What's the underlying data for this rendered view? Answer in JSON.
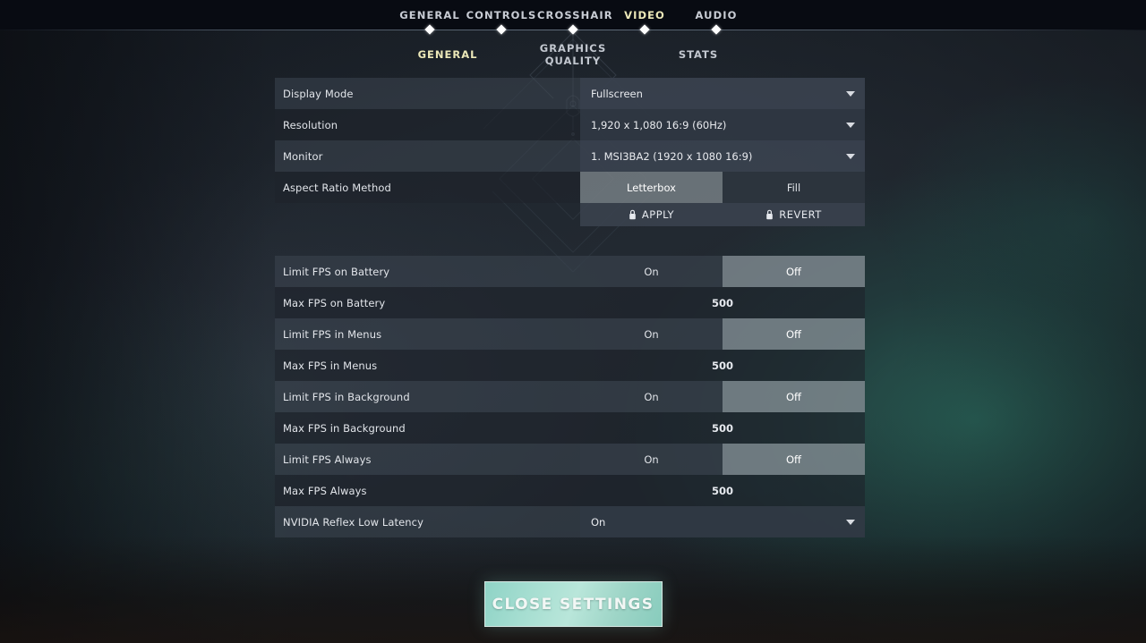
{
  "nav": {
    "main": [
      {
        "label": "GENERAL",
        "active": false
      },
      {
        "label": "CONTROLS",
        "active": false
      },
      {
        "label": "CROSSHAIR",
        "active": false
      },
      {
        "label": "VIDEO",
        "active": true
      },
      {
        "label": "AUDIO",
        "active": false
      }
    ],
    "sub": [
      {
        "label": "GENERAL",
        "active": true
      },
      {
        "label": "GRAPHICS QUALITY",
        "active": false
      },
      {
        "label": "STATS",
        "active": false
      }
    ]
  },
  "colors": {
    "active_tab": "#ece8b8",
    "tab": "#c8ccd4",
    "selected_option_bg": "#96a0a4",
    "close_button": "#a6ded1",
    "panel_row_light": "#3d4550",
    "panel_row_dark": "#1e242c"
  },
  "settings": {
    "display_mode": {
      "label": "Display Mode",
      "value": "Fullscreen",
      "type": "dropdown"
    },
    "resolution": {
      "label": "Resolution",
      "value": "1,920 x 1,080 16:9 (60Hz)",
      "type": "dropdown"
    },
    "monitor": {
      "label": "Monitor",
      "value": "1. MSI3BA2 (1920 x  1080 16:9)",
      "type": "dropdown"
    },
    "aspect_ratio_method": {
      "label": "Aspect Ratio Method",
      "type": "segmented",
      "options": [
        "Letterbox",
        "Fill"
      ],
      "selected": "Letterbox"
    },
    "actions": {
      "apply": "APPLY",
      "revert": "REVERT",
      "key_icon": "keybind-icon"
    },
    "limit_fps_battery": {
      "label": "Limit FPS on Battery",
      "type": "segmented",
      "options": [
        "On",
        "Off"
      ],
      "selected": "Off"
    },
    "max_fps_battery": {
      "label": "Max FPS on Battery",
      "value": "500",
      "type": "number"
    },
    "limit_fps_menus": {
      "label": "Limit FPS in Menus",
      "type": "segmented",
      "options": [
        "On",
        "Off"
      ],
      "selected": "Off"
    },
    "max_fps_menus": {
      "label": "Max FPS in Menus",
      "value": "500",
      "type": "number"
    },
    "limit_fps_background": {
      "label": "Limit FPS in Background",
      "type": "segmented",
      "options": [
        "On",
        "Off"
      ],
      "selected": "Off"
    },
    "max_fps_background": {
      "label": "Max FPS in Background",
      "value": "500",
      "type": "number"
    },
    "limit_fps_always": {
      "label": "Limit FPS Always",
      "type": "segmented",
      "options": [
        "On",
        "Off"
      ],
      "selected": "Off"
    },
    "max_fps_always": {
      "label": "Max FPS Always",
      "value": "500",
      "type": "number"
    },
    "nvidia_reflex": {
      "label": "NVIDIA Reflex Low Latency",
      "value": "On",
      "type": "dropdown"
    }
  },
  "footer": {
    "close_label": "CLOSE SETTINGS"
  }
}
